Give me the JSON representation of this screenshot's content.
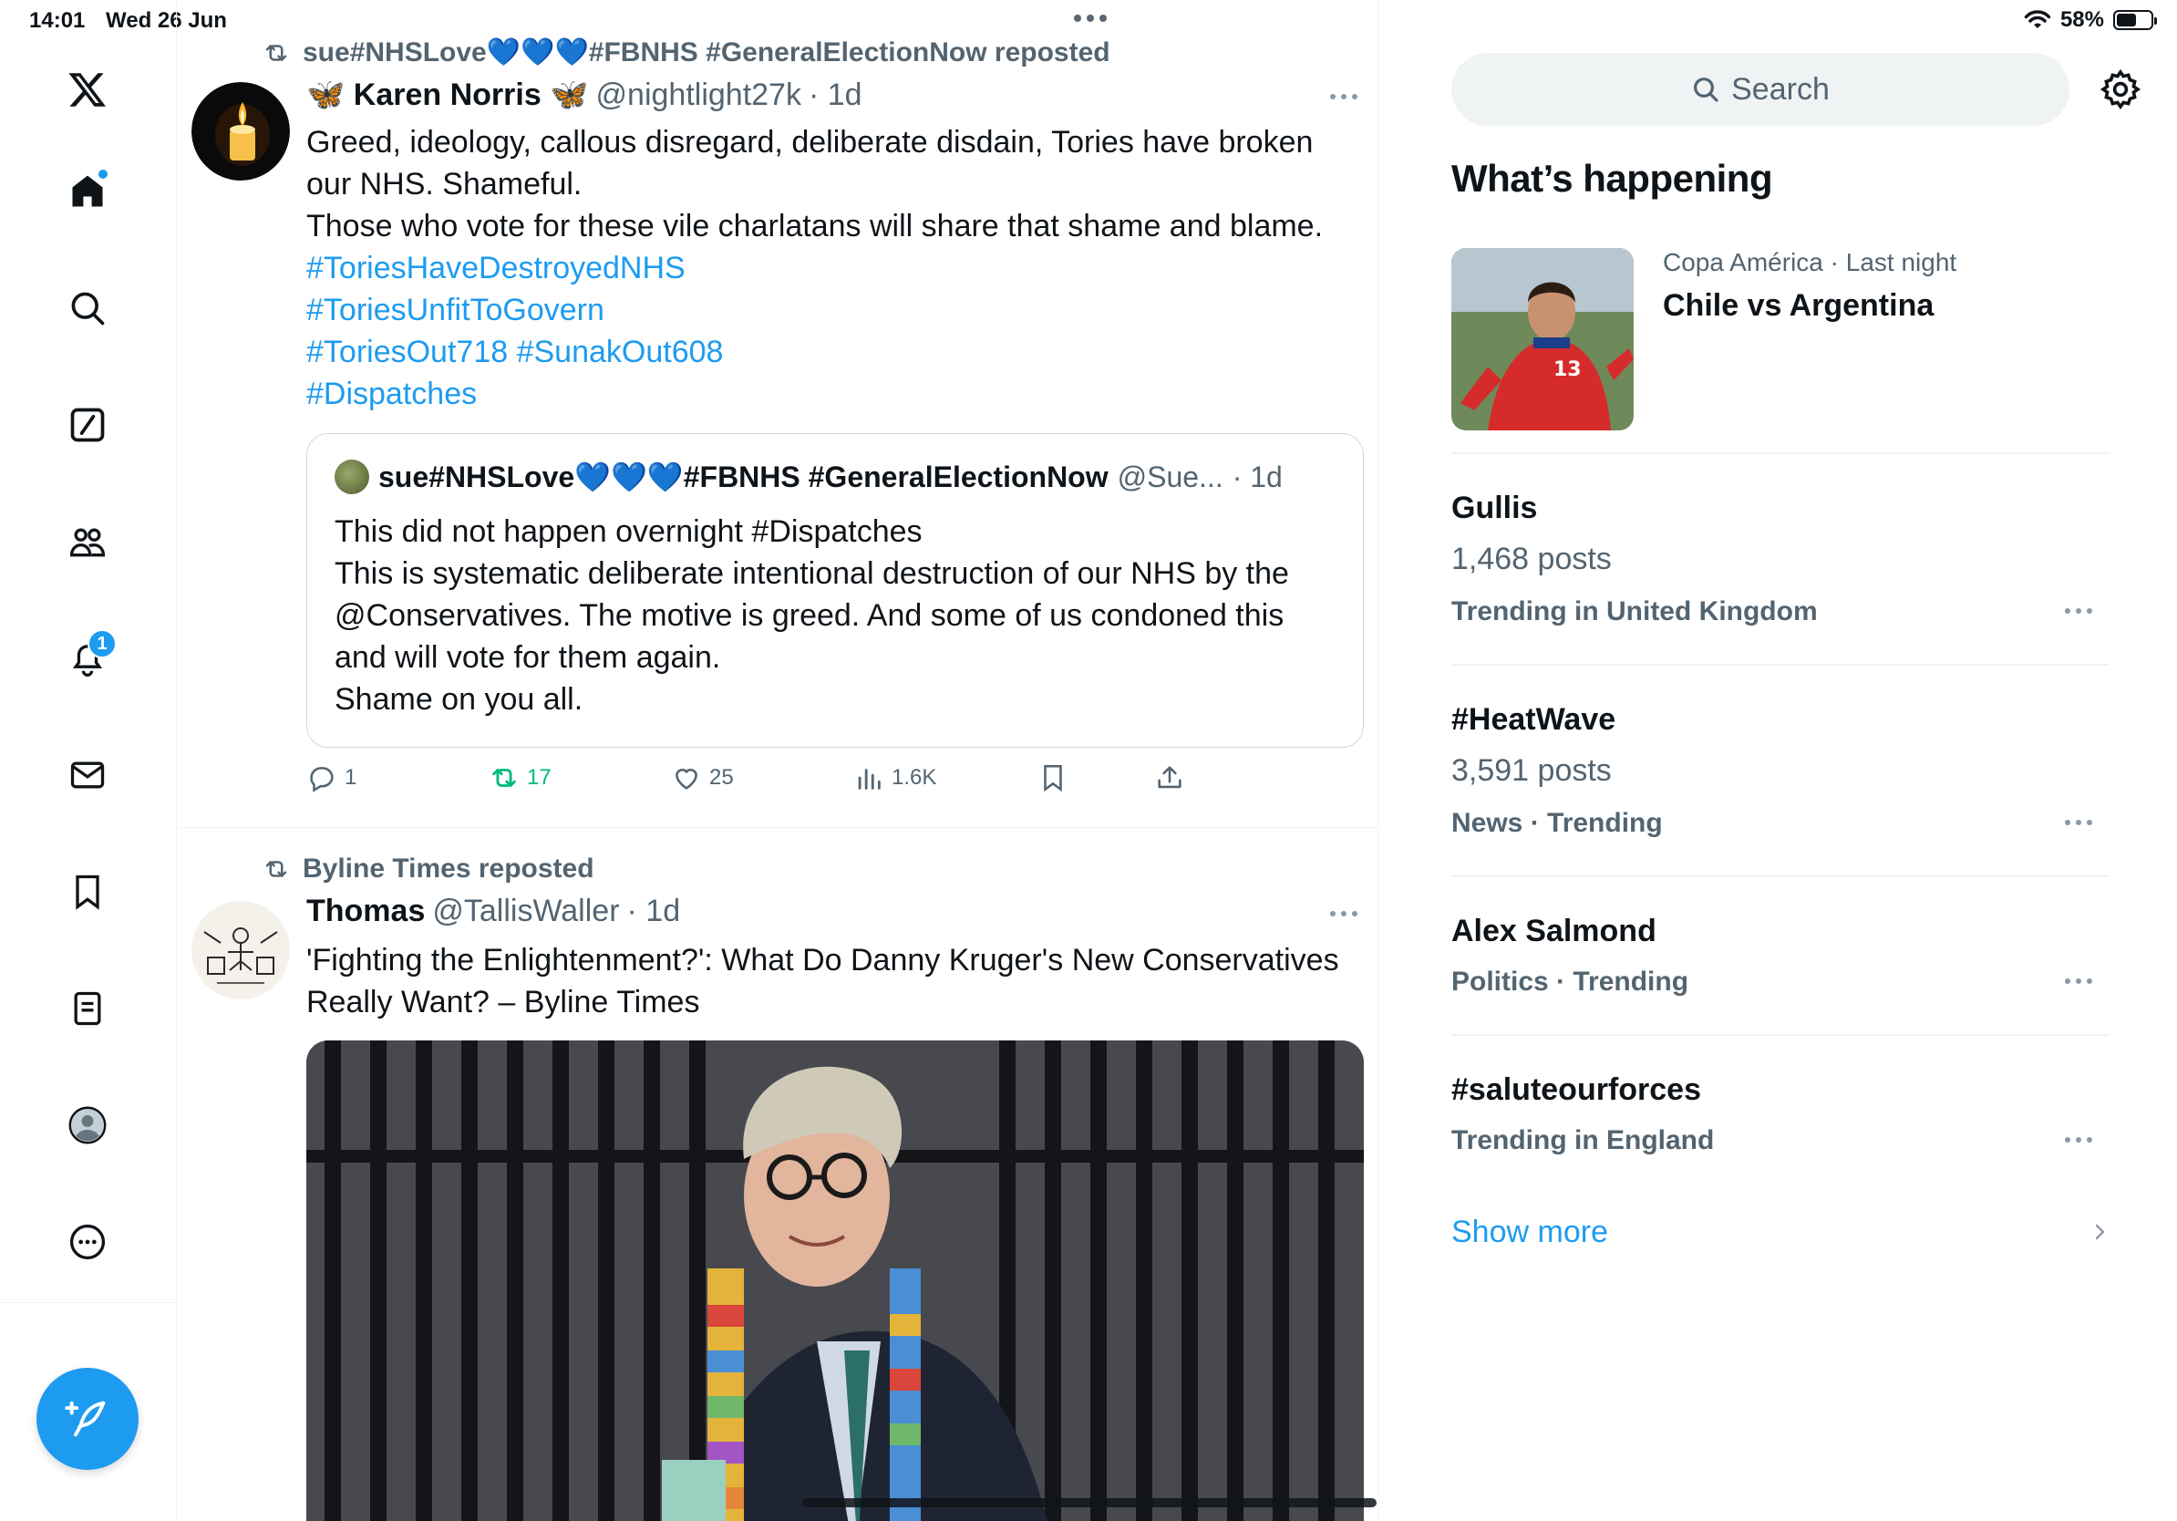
{
  "status_bar": {
    "time": "14:01",
    "date": "Wed 26 Jun",
    "battery": "58%",
    "battery_level": 0.58
  },
  "nav": {
    "items": [
      "x-logo",
      "home",
      "explore",
      "grok",
      "communities",
      "notifications",
      "messages",
      "bookmarks",
      "lists",
      "profile",
      "more"
    ],
    "notifications_badge": "1"
  },
  "feed": {
    "posts": [
      {
        "repost_by": "sue#NHSLove💙💙💙#FBNHS #GeneralElectionNow reposted",
        "name": "🦋 Karen Norris 🦋",
        "handle": "@nightlight27k",
        "time": "· 1d",
        "text_lines": [
          "Greed, ideology, callous disregard, deliberate disdain, Tories have broken",
          "our NHS. Shameful.",
          "Those who vote for these vile charlatans will share that shame and blame."
        ],
        "hashtags": [
          "#ToriesHaveDestroyedNHS",
          "#ToriesUnfitToGovern",
          "#ToriesOut718 #SunakOut608",
          "#Dispatches"
        ],
        "quote": {
          "name": "sue#NHSLove💙💙💙#FBNHS #GeneralElectionNow",
          "handle": "@Sue...",
          "time": "· 1d",
          "text_lines": [
            "This did not happen overnight #Dispatches",
            "This is systematic deliberate intentional destruction of our NHS by the",
            "@Conservatives. The motive is greed. And some of us condoned this",
            "and will vote for them again.",
            "Shame on you all."
          ]
        },
        "stats": {
          "replies": "1",
          "reposts": "17",
          "likes": "25",
          "views": "1.6K"
        }
      },
      {
        "repost_by": "Byline Times reposted",
        "name": "Thomas",
        "handle": "@TallisWaller",
        "time": "· 1d",
        "text_lines": [
          "'Fighting the Enlightenment?': What Do Danny Kruger's New Conservatives",
          "Really Want? – Byline Times"
        ]
      }
    ]
  },
  "right": {
    "search_placeholder": "Search",
    "section_title": "What’s happening",
    "featured": {
      "meta": "Copa América · Last night",
      "title": "Chile vs Argentina"
    },
    "trends": [
      {
        "title": "Gullis",
        "posts": "1,468 posts",
        "context": "Trending in United Kingdom"
      },
      {
        "title": "#HeatWave",
        "posts": "3,591 posts",
        "context": "News · Trending"
      },
      {
        "title": "Alex Salmond",
        "context": "Politics · Trending"
      },
      {
        "title": "#saluteourforces",
        "context": "Trending in England"
      }
    ],
    "show_more": "Show more"
  },
  "colors": {
    "accent": "#1d9bf0",
    "repost_green": "#00ba7c",
    "muted": "#536471",
    "text": "#0f1419"
  }
}
